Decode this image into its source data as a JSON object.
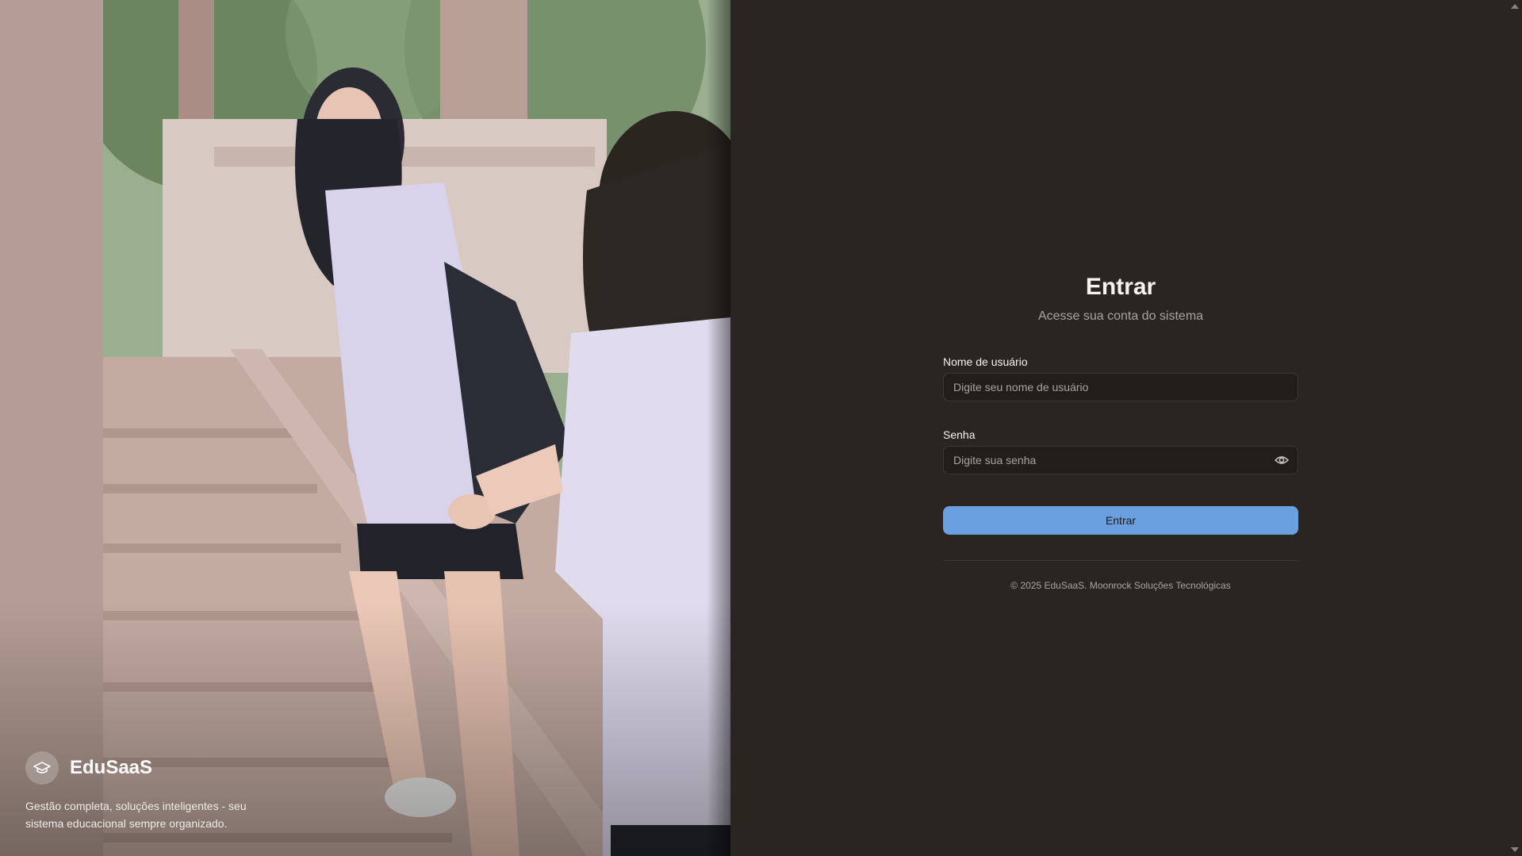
{
  "hero": {
    "image": "students-on-stairs-photo",
    "brand_icon": "graduation-cap-icon",
    "brand_name": "EduSaaS",
    "tagline": "Gestão completa, soluções inteligentes - seu sistema educacional sempre organizado."
  },
  "login": {
    "title": "Entrar",
    "subtitle": "Acesse sua conta do sistema",
    "username_label": "Nome de usuário",
    "username_placeholder": "Digite seu nome de usuário",
    "password_label": "Senha",
    "password_placeholder": "Digite sua senha",
    "password_toggle_icon": "eye-icon",
    "submit_label": "Entrar",
    "footer": "© 2025 EduSaaS. Moonrock Soluções Tecnológicas"
  },
  "colors": {
    "panel_background": "#2b2522",
    "primary_button": "#6ba0e0",
    "input_background": "#221d1a"
  }
}
